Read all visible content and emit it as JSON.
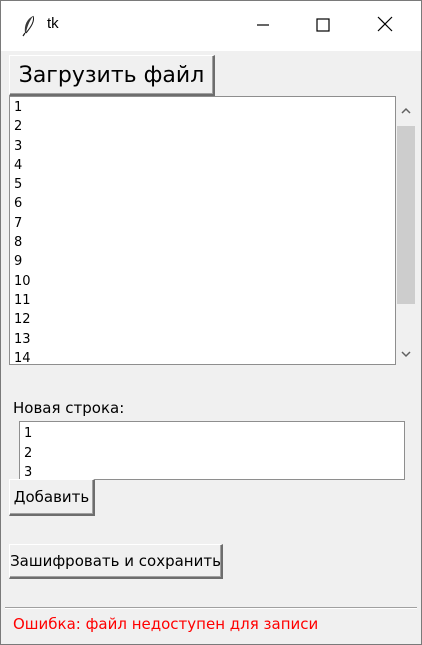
{
  "window": {
    "title": "tk",
    "icons": {
      "app": "feather-icon",
      "minimize": "minimize-icon",
      "maximize": "maximize-icon",
      "close": "close-icon"
    }
  },
  "toolbar": {
    "load_label": "Загрузить файл"
  },
  "file_list": {
    "lines": [
      "1",
      "2",
      "3",
      "4",
      "5",
      "6",
      "7",
      "8",
      "9",
      "10",
      "11",
      "12",
      "13",
      "14"
    ],
    "scrollbar": {
      "up_icon": "chevron-up-icon",
      "down_icon": "chevron-down-icon"
    }
  },
  "new_line": {
    "label": "Новая строка:",
    "lines": [
      "1",
      "2",
      "3"
    ]
  },
  "actions": {
    "add_label": "Добавить",
    "encrypt_save_label": "Зашифровать и сохранить"
  },
  "status": {
    "text": "Ошибка: файл недоступен для записи",
    "color": "#ff0000"
  }
}
